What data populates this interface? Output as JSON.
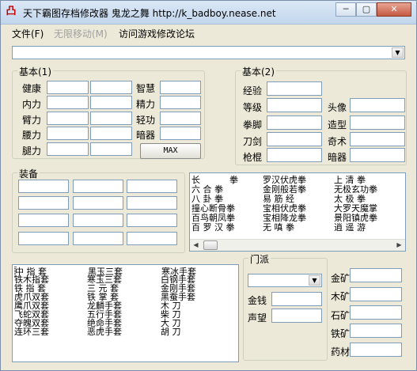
{
  "window": {
    "title": "天下霸图存档修改器 鬼龙之舞 http://k_badboy.nease.net",
    "caption_min": "─",
    "caption_max": "▢",
    "caption_close": "✕",
    "app_icon_glyph": "凸"
  },
  "menu": {
    "file": "文件(F)",
    "infinite_move": "无限移动(M)",
    "forum": "访问游戏修改论坛"
  },
  "top_combo": {
    "value": "",
    "arrow": "▼"
  },
  "basic1": {
    "title": "基本(1)",
    "labels": [
      "健康",
      "内力",
      "臂力",
      "腰力",
      "腿力"
    ],
    "labels_right": [
      "智慧",
      "精力",
      "轻功",
      "暗器"
    ],
    "max_button": "MAX"
  },
  "basic2": {
    "title": "基本(2)",
    "labels_left": [
      "经验",
      "等级",
      "拳脚",
      "刀剑",
      "枪棍"
    ],
    "labels_right": [
      "头像",
      "造型",
      "奇术",
      "暗器"
    ]
  },
  "equipment": {
    "title": "装备"
  },
  "skills_list": {
    "rows": [
      [
        "长",
        "拳",
        "罗汉伏虎拳",
        "上 清 拳"
      ],
      [
        "六 合 拳",
        "金刚般若拳",
        "无极玄功拳"
      ],
      [
        "八 卦 拳",
        "易 筋 经",
        "太 极 拳"
      ],
      [
        "撞心断骨拳",
        "宝相伏虎拳",
        "大罗天魔掌"
      ],
      [
        "百鸟朝凤拳",
        "宝相降龙拳",
        "景阳镇虎拳"
      ],
      [
        "百 罗 汉 拳",
        "无 嗔 拳",
        "逍 遥 游"
      ]
    ]
  },
  "weapons_list": {
    "rows": [
      [
        "中 指 套",
        "黑玉三套",
        "寒冰手套"
      ],
      [
        "铁木指套",
        "寒玉三套",
        "白钢手套"
      ],
      [
        "铁 指 套",
        "三 元 套",
        "金刚手套"
      ],
      [
        "虎爪双套",
        "铁 掌 套",
        "黑蚕手套"
      ],
      [
        "鹰爪双套",
        "龙麟手套",
        "木 刀"
      ],
      [
        "飞蛇双套",
        "五行手套",
        "柴 刀"
      ],
      [
        "夺魄双套",
        "绝命手套",
        "大 刀"
      ],
      [
        "连环三套",
        "恶虎手套",
        "胡 刀"
      ]
    ]
  },
  "faction": {
    "title": "门派",
    "labels": [
      "金钱",
      "声望"
    ],
    "mine_labels": [
      "金矿",
      "木矿",
      "石矿",
      "铁矿",
      "药材"
    ]
  },
  "scroll": {
    "left": "◀",
    "right": "▶"
  }
}
